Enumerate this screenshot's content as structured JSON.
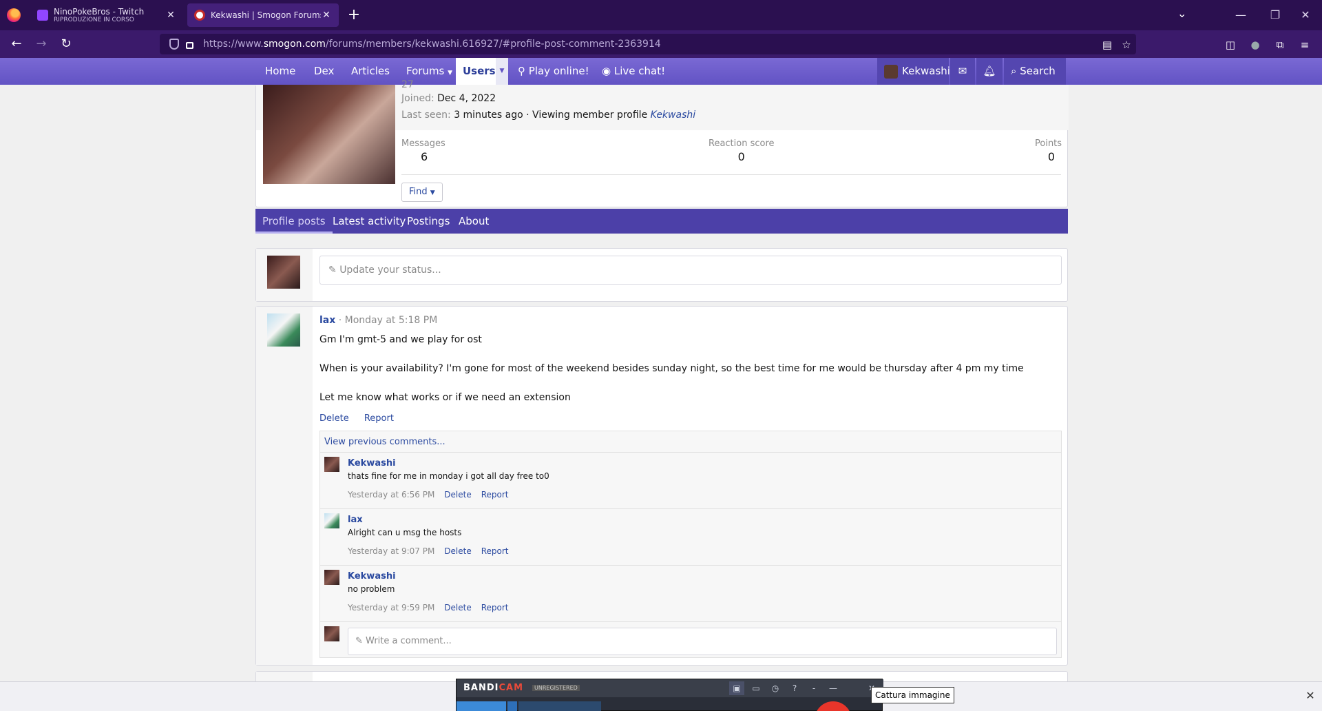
{
  "browser": {
    "tabs": [
      {
        "title": "NinoPokeBros - Twitch",
        "subtitle": "RIPRODUZIONE IN CORSO"
      },
      {
        "title": "Kekwashi | Smogon Forums",
        "subtitle": ""
      }
    ],
    "url_prefix": "https://www.",
    "url_domain": "smogon.com",
    "url_path": "/forums/members/kekwashi.616927/#profile-post-comment-2363914"
  },
  "nav": {
    "items": [
      "Home",
      "Dex",
      "Articles",
      "Forums",
      "Users",
      "Play online!",
      "Live chat!"
    ],
    "account_name": "Kekwashi",
    "search_label": "Search"
  },
  "profile": {
    "partial_line": "27",
    "joined_label": "Joined:",
    "joined_value": "Dec 4, 2022",
    "lastseen_label": "Last seen:",
    "lastseen_value": "3 minutes ago · Viewing member profile",
    "lastseen_link": "Kekwashi",
    "stats": [
      {
        "label": "Messages",
        "value": "6"
      },
      {
        "label": "Reaction score",
        "value": "0"
      },
      {
        "label": "Points",
        "value": "0"
      }
    ],
    "find_label": "Find"
  },
  "profile_tabs": [
    "Profile posts",
    "Latest activity",
    "Postings",
    "About"
  ],
  "status_placeholder": "Update your status...",
  "post": {
    "user": "lax",
    "time": "· Monday at 5:18 PM",
    "lines": [
      "Gm I'm gmt-5 and we play for ost",
      "When is your availability? I'm gone for most of the weekend besides sunday night, so the best time for me would be thursday after 4 pm my time",
      "Let me know what works or if we need an extension"
    ],
    "actions": [
      "Delete",
      "Report"
    ],
    "view_previous": "View previous comments...",
    "comments": [
      {
        "user": "Kekwashi",
        "text": "thats fine for me in monday i got all day free to0",
        "time": "Yesterday at 6:56 PM"
      },
      {
        "user": "lax",
        "text": "Alright can u msg the hosts",
        "time": "Yesterday at 9:07 PM"
      },
      {
        "user": "Kekwashi",
        "text": "no problem",
        "time": "Yesterday at 9:59 PM"
      }
    ],
    "comment_actions": [
      "Delete",
      "Report"
    ],
    "write_placeholder": "Write a comment..."
  },
  "bandicam": {
    "logo_a": "BANDI",
    "logo_b": "CAM",
    "unregistered": "UNREGISTERED",
    "tooltip": "Cattura immagine"
  }
}
